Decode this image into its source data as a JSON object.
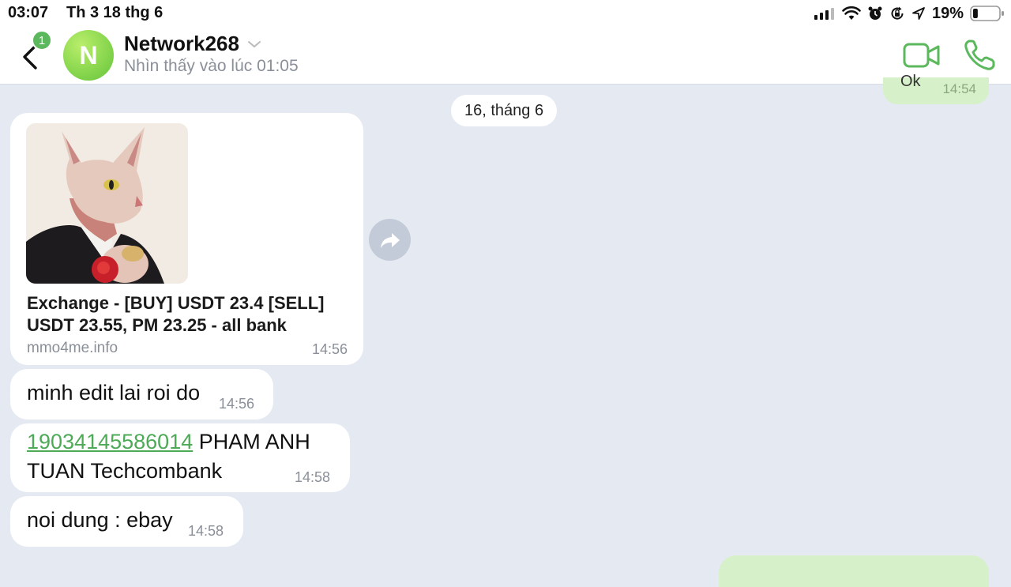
{
  "status_bar": {
    "time": "03:07",
    "date": "Th 3 18 thg 6",
    "battery_percent": "19%",
    "battery_level": 0.19,
    "icons": [
      "cellular-signal-icon",
      "wifi-icon",
      "alarm-icon",
      "orientation-lock-icon",
      "location-icon",
      "battery-icon"
    ]
  },
  "header": {
    "unread_badge": "1",
    "avatar_initial": "N",
    "contact_name": "Network268",
    "last_seen": "Nhìn thấy vào lúc 01:05",
    "accent_color": "#5cb85c"
  },
  "chat": {
    "partial_outgoing_time": "14:54",
    "partial_outgoing_text": "Ok",
    "date_separator": "16, tháng 6",
    "messages": [
      {
        "type": "link",
        "title": "Exchange - [BUY] USDT 23.4 [SELL] USDT 23.55, PM 23.25 - all bank",
        "domain": "mmo4me.info",
        "time": "14:56"
      },
      {
        "type": "text",
        "text": "minh edit lai roi do",
        "time": "14:56"
      },
      {
        "type": "text",
        "link_text": "19034145586014",
        "text": " PHAM ANH TUAN Techcombank",
        "time": "14:58"
      },
      {
        "type": "text",
        "text": "noi dung : ebay",
        "time": "14:58"
      }
    ]
  },
  "colors": {
    "chat_background": "#e4e9f2",
    "incoming_bubble": "#ffffff",
    "outgoing_bubble": "#d6f1c9",
    "link_color": "#4daa57"
  }
}
